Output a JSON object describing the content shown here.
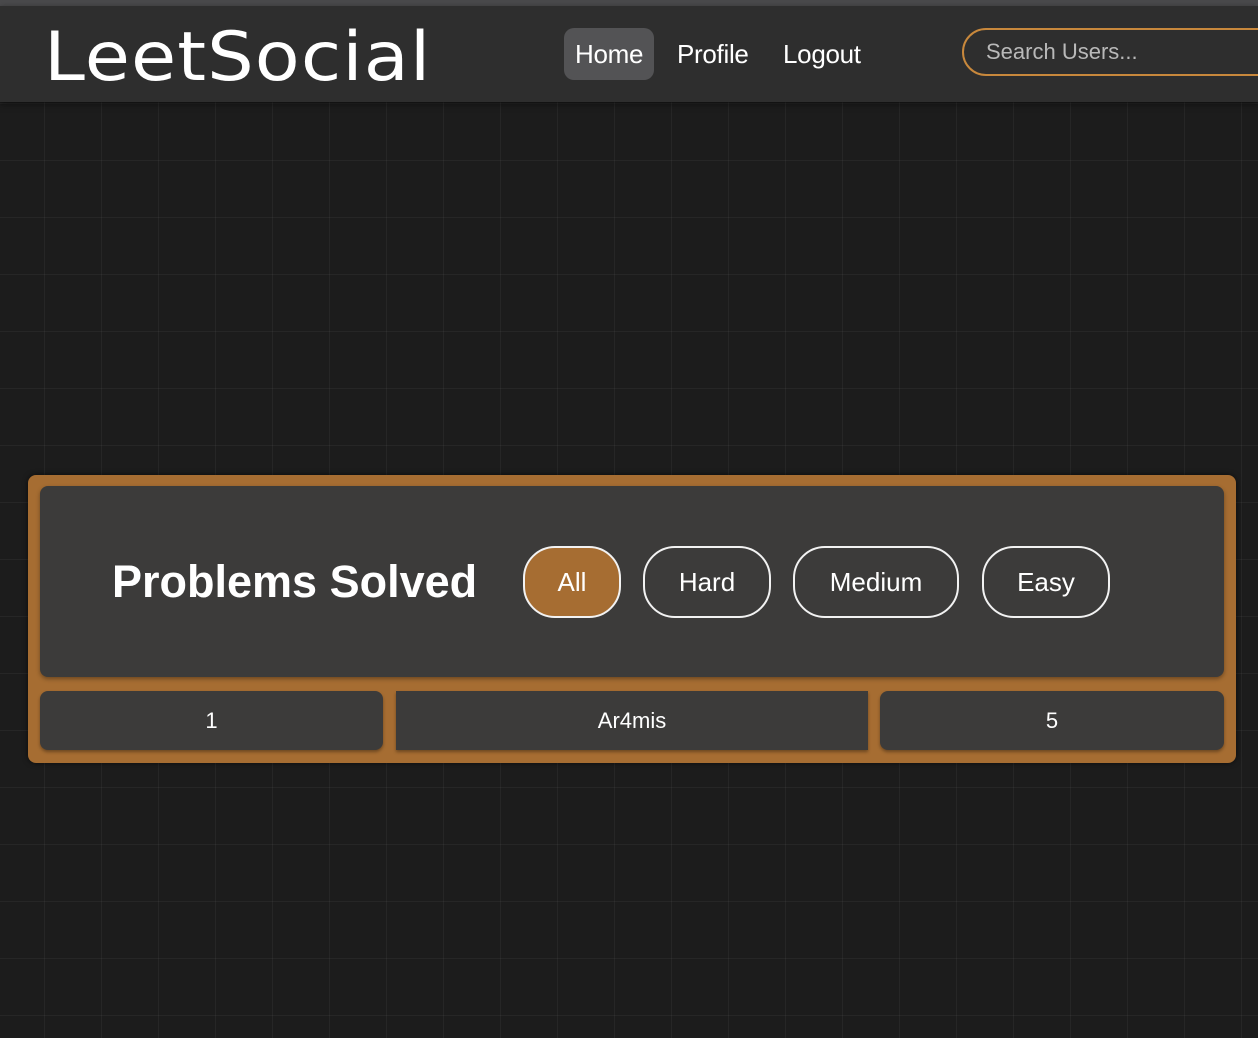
{
  "navbar": {
    "brand": "LeetSocial",
    "links": [
      {
        "label": "Home",
        "active": true
      },
      {
        "label": "Profile",
        "active": false
      },
      {
        "label": "Logout",
        "active": false
      }
    ],
    "search": {
      "placeholder": "Search Users...",
      "value": ""
    }
  },
  "panel": {
    "title": "Problems Solved",
    "filters": [
      {
        "label": "All",
        "active": true
      },
      {
        "label": "Hard",
        "active": false
      },
      {
        "label": "Medium",
        "active": false
      },
      {
        "label": "Easy",
        "active": false
      }
    ],
    "rows": [
      {
        "rank": "1",
        "user": "Ar4mis",
        "count": "5"
      }
    ]
  },
  "colors": {
    "accent": "#a66d32",
    "background": "#1c1c1c",
    "navbar": "#2e2e2e",
    "card": "#3c3b3a"
  }
}
